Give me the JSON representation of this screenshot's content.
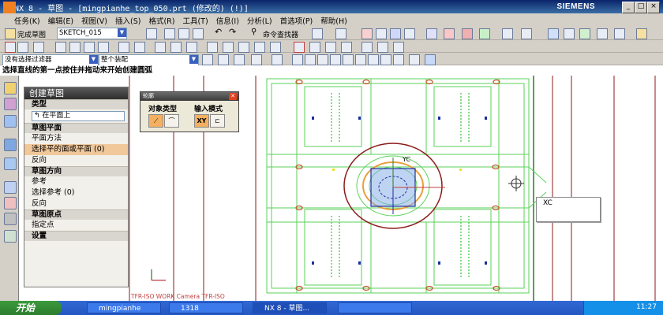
{
  "window": {
    "title": "NX 8 - 草图 - [mingpianhe_top_050.prt  (修改的)    (!)]",
    "brand": "SIEMENS"
  },
  "menu": [
    "任务(K)",
    "编辑(E)",
    "视图(V)",
    "插入(S)",
    "格式(R)",
    "工具(T)",
    "信息(I)",
    "分析(L)",
    "首选项(P)",
    "帮助(H)"
  ],
  "toolbar1": {
    "finish_sketch": "完成草图",
    "sketch_name": "SKETCH_015",
    "command_finder": "命令查找器"
  },
  "selection": {
    "filter": "没有选择过滤器",
    "scope": "整个装配"
  },
  "cue": "选择直线的第一点按住并拖动来开始创建圆弧",
  "create_sketch_dialog": {
    "title": "创建草图",
    "type_section": "类型",
    "type_value": "在平面上",
    "plane_section": "草图平面",
    "plane_method": "平面方法",
    "select_plane": "选择平的面或平面 (0)",
    "reverse1": "反向",
    "orient_section": "草图方向",
    "reference": "参考",
    "select_reference": "选择参考 (0)",
    "reverse2": "反向",
    "origin_section": "草图原点",
    "specify_point": "指定点",
    "settings_section": "设置"
  },
  "profile_popup": {
    "title": "轮廓",
    "object_type": "对象类型",
    "input_mode": "输入模式",
    "xy_label": "XY"
  },
  "viewport": {
    "yc_label": "YC",
    "xc_label": "XC",
    "status": "TFR-ISO WORK Camera TFR-ISO"
  },
  "taskbar": {
    "start": "开始",
    "tasks": [
      "mingpianhe",
      "1318",
      "NX 8 - 草图...",
      ""
    ],
    "clock": "11:27"
  },
  "colors": {
    "green_lines": "#5ad25a",
    "dark_red": "#8b1a1a",
    "orange_circle": "#e8a040",
    "blue_axis": "#1a2f9c"
  }
}
